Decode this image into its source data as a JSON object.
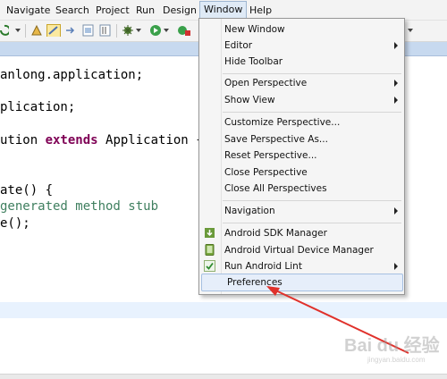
{
  "menubar": {
    "items": [
      {
        "label": "Navigate"
      },
      {
        "label": "Search"
      },
      {
        "label": "Project"
      },
      {
        "label": "Run"
      },
      {
        "label": "Design"
      },
      {
        "label": "Window"
      },
      {
        "label": "Help"
      }
    ]
  },
  "code": {
    "lines": [
      "anlong.application;",
      "plication;",
      "ution ",
      "ate() {",
      "generated method stub",
      "e();"
    ],
    "extends_kw": "extends",
    "extends_rest": " Application {"
  },
  "window_menu": {
    "items": [
      {
        "label": "New Window"
      },
      {
        "label": "Editor"
      },
      {
        "label": "Hide Toolbar"
      },
      {
        "label": "Open Perspective"
      },
      {
        "label": "Show View"
      },
      {
        "label": "Customize Perspective..."
      },
      {
        "label": "Save Perspective As..."
      },
      {
        "label": "Reset Perspective..."
      },
      {
        "label": "Close Perspective"
      },
      {
        "label": "Close All Perspectives"
      },
      {
        "label": "Navigation"
      },
      {
        "label": "Android SDK Manager",
        "icon": "android-sdk-icon"
      },
      {
        "label": "Android Virtual Device Manager",
        "icon": "android-avd-icon"
      },
      {
        "label": "Run Android Lint",
        "icon": "lint-check-icon"
      },
      {
        "label": "Preferences"
      }
    ]
  },
  "watermark": {
    "logo": "Bai du 经验",
    "url": "jingyan.baidu.com"
  },
  "colors": {
    "keyword": "#7f0055",
    "comment": "#3f7f5f",
    "arrow": "#e0312b",
    "menu_highlight": "#e6eefa"
  }
}
